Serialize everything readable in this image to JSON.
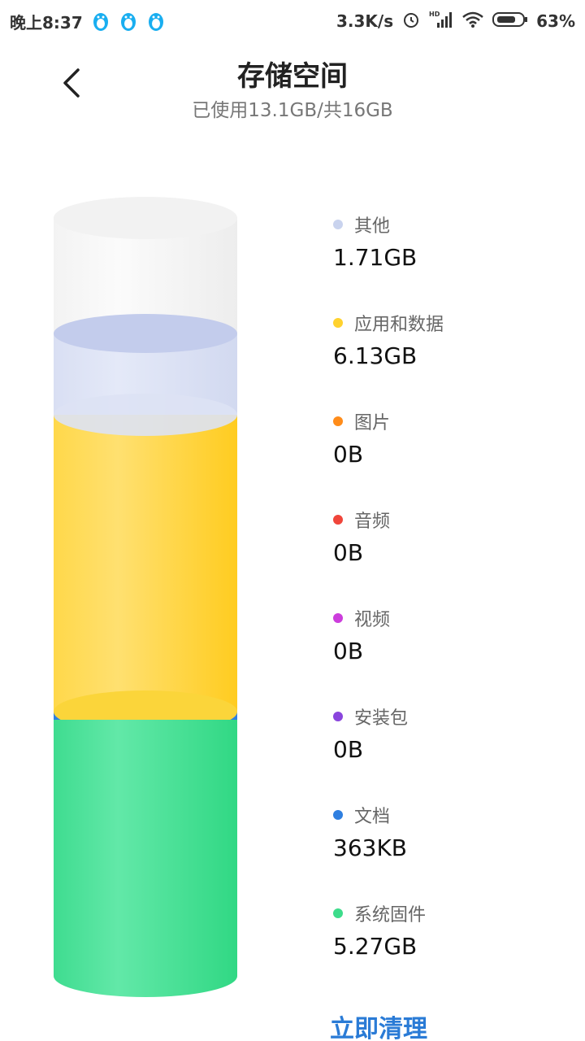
{
  "status_bar": {
    "time": "晚上8:37",
    "network_speed": "3.3K/s",
    "battery_percent": "63%",
    "icons": [
      "qq-penguin-icon",
      "qq-penguin-icon",
      "qq-penguin-icon",
      "alarm-icon",
      "hd-signal-icon",
      "wifi-icon",
      "battery-icon"
    ]
  },
  "header": {
    "title": "存储空间",
    "subtitle": "已使用13.1GB/共16GB"
  },
  "legend": [
    {
      "label": "其他",
      "value": "1.71GB",
      "color": "#c9d3ee"
    },
    {
      "label": "应用和数据",
      "value": "6.13GB",
      "color": "#ffd22e"
    },
    {
      "label": "图片",
      "value": "0B",
      "color": "#ff8c1a"
    },
    {
      "label": "音频",
      "value": "0B",
      "color": "#f0453a"
    },
    {
      "label": "视频",
      "value": "0B",
      "color": "#cc3ddc"
    },
    {
      "label": "安装包",
      "value": "0B",
      "color": "#8a45dd"
    },
    {
      "label": "文档",
      "value": "363KB",
      "color": "#2f7fe0"
    },
    {
      "label": "系统固件",
      "value": "5.27GB",
      "color": "#3ddc8b"
    }
  ],
  "action": {
    "clean_label": "立即清理",
    "color": "#2a7bd6"
  }
}
